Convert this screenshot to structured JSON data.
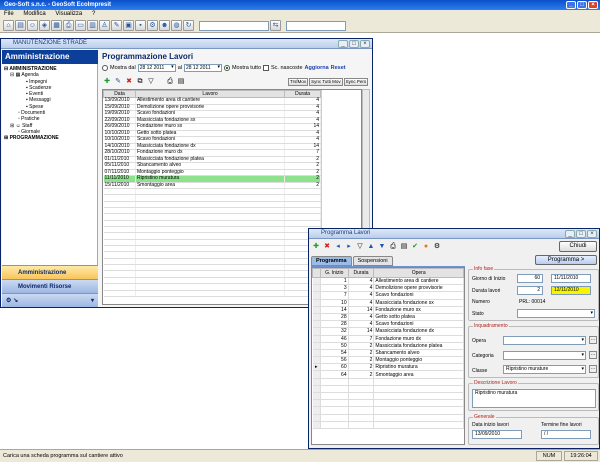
{
  "app": {
    "title": "Geo-Soft s.n.c. - GeoSoft EcoImpresit",
    "menu": [
      "File",
      "Modifica",
      "Visualizza",
      "?"
    ]
  },
  "win1": {
    "title": "MANUTENZIONE STRADE",
    "sidebar": {
      "header": "Amministrazione",
      "tree": [
        {
          "level": 0,
          "label": "AMMINISTRAZIONE"
        },
        {
          "level": 1,
          "label": "Agenda"
        },
        {
          "level": 2,
          "label": "Impegni"
        },
        {
          "level": 2,
          "label": "Scadenze"
        },
        {
          "level": 2,
          "label": "Eventi"
        },
        {
          "level": 2,
          "label": "Messaggi"
        },
        {
          "level": 2,
          "label": "Spese"
        },
        {
          "level": 1,
          "label": "Documenti"
        },
        {
          "level": 1,
          "label": "Pratiche"
        },
        {
          "level": 1,
          "label": "Staff"
        },
        {
          "level": 1,
          "label": "Giornale"
        },
        {
          "level": 0,
          "label": "PROGRAMMAZIONE"
        }
      ],
      "tabs": [
        "Amministrazione",
        "Movimenti Risorse"
      ]
    },
    "heading": "Programmazione Lavori",
    "filter": {
      "mostra_dal": "Mostra dal",
      "date_from": "28 12 2011",
      "al": "al",
      "date_to": "28 12 2011",
      "mostra_tutto": "Mostra tutto",
      "sc_nascoste": "Sc. nascoste",
      "aggiorna": "Aggiorna",
      "reset": "Reset"
    },
    "buttons": [
      "TrsfMov",
      "Sync Tutti Mov",
      "Sync Pers"
    ],
    "columns": [
      "Data",
      "Lavoro",
      "Durata"
    ],
    "rows": [
      {
        "data": "13/09/2010",
        "lavoro": "Allestimento area di cantiere",
        "durata": "4"
      },
      {
        "data": "15/09/2010",
        "lavoro": "Demolizione opere provvisorie",
        "durata": "4"
      },
      {
        "data": "19/09/2010",
        "lavoro": "Scavo fondazioni",
        "durata": "4"
      },
      {
        "data": "22/09/2010",
        "lavoro": "Massicciata fondazione sx",
        "durata": "4"
      },
      {
        "data": "26/09/2010",
        "lavoro": "Fondazione muro sx",
        "durata": "14"
      },
      {
        "data": "10/10/2010",
        "lavoro": "Getto sotto platea",
        "durata": "4"
      },
      {
        "data": "10/10/2010",
        "lavoro": "Scavo fondazioni",
        "durata": "4"
      },
      {
        "data": "14/10/2010",
        "lavoro": "Massicciata fondazione dx",
        "durata": "14"
      },
      {
        "data": "28/10/2010",
        "lavoro": "Fondazione muro dx",
        "durata": "7"
      },
      {
        "data": "01/11/2010",
        "lavoro": "Massicciata fondazione platea",
        "durata": "2"
      },
      {
        "data": "05/11/2010",
        "lavoro": "Sbancamento alveo",
        "durata": "2"
      },
      {
        "data": "07/11/2010",
        "lavoro": "Montaggio ponteggio",
        "durata": "2"
      },
      {
        "data": "11/11/2010",
        "lavoro": "Ripristino muratura",
        "durata": "2",
        "selected": true
      },
      {
        "data": "15/11/2010",
        "lavoro": "Smontaggio area",
        "durata": "2"
      }
    ],
    "empty_rows": 17
  },
  "win2": {
    "title": "Programma Lavori",
    "chiudi": "Chiudi",
    "programma_btn": "Programma >",
    "tabs": [
      "Programma",
      "Sospensioni"
    ],
    "columns": [
      "G. Inizio",
      "Durata",
      "Opera"
    ],
    "rows": [
      {
        "g": "1",
        "d": "4",
        "opera": "Allestimento area di cantiere"
      },
      {
        "g": "3",
        "d": "4",
        "opera": "Demolizione opere provvisorie"
      },
      {
        "g": "7",
        "d": "4",
        "opera": "Scavo fondazioni"
      },
      {
        "g": "10",
        "d": "4",
        "opera": "Massicciata fondazione sx"
      },
      {
        "g": "14",
        "d": "14",
        "opera": "Fondazione muro sx"
      },
      {
        "g": "28",
        "d": "4",
        "opera": "Getto sotto platea"
      },
      {
        "g": "28",
        "d": "4",
        "opera": "Scavo fondazioni"
      },
      {
        "g": "32",
        "d": "14",
        "opera": "Massicciata fondazione dx"
      },
      {
        "g": "46",
        "d": "7",
        "opera": "Fondazione muro dx"
      },
      {
        "g": "50",
        "d": "2",
        "opera": "Massicciata fondazione platea"
      },
      {
        "g": "54",
        "d": "2",
        "opera": "Sbancamento alveo"
      },
      {
        "g": "56",
        "d": "2",
        "opera": "Montaggio ponteggio"
      },
      {
        "g": "60",
        "d": "2",
        "opera": "Ripristino muratura"
      },
      {
        "g": "64",
        "d": "2",
        "opera": "Smontaggio area"
      }
    ],
    "empty_rows": 7,
    "info": {
      "title": "Info fase",
      "giorno_label": "Giorno di Inizio",
      "giorno": "60",
      "giorno_date": "11/11/2010",
      "durata_label": "Durata lavori",
      "durata": "2",
      "durata_date": "12/11/2010",
      "numero_label": "Numero",
      "numero": "PRL: 00014",
      "stato_label": "Stato"
    },
    "inq": {
      "title": "Inquadramento",
      "opera_label": "Opera",
      "categoria_label": "Categoria",
      "classe_label": "Classe",
      "classe": "Ripristino murature"
    },
    "descr": {
      "title": "Descrizione Lavoro",
      "text": "Ripristino muratura"
    },
    "generale": {
      "title": "Generale",
      "inizio_label": "Data inizio lavori",
      "inizio": "13/09/2010",
      "fine_label": "Termine fine lavori",
      "fine": " / / "
    }
  },
  "status": {
    "text": "Carica una scheda programma sul cantiere attivo",
    "num": "NUM",
    "time": "19:26:04"
  }
}
